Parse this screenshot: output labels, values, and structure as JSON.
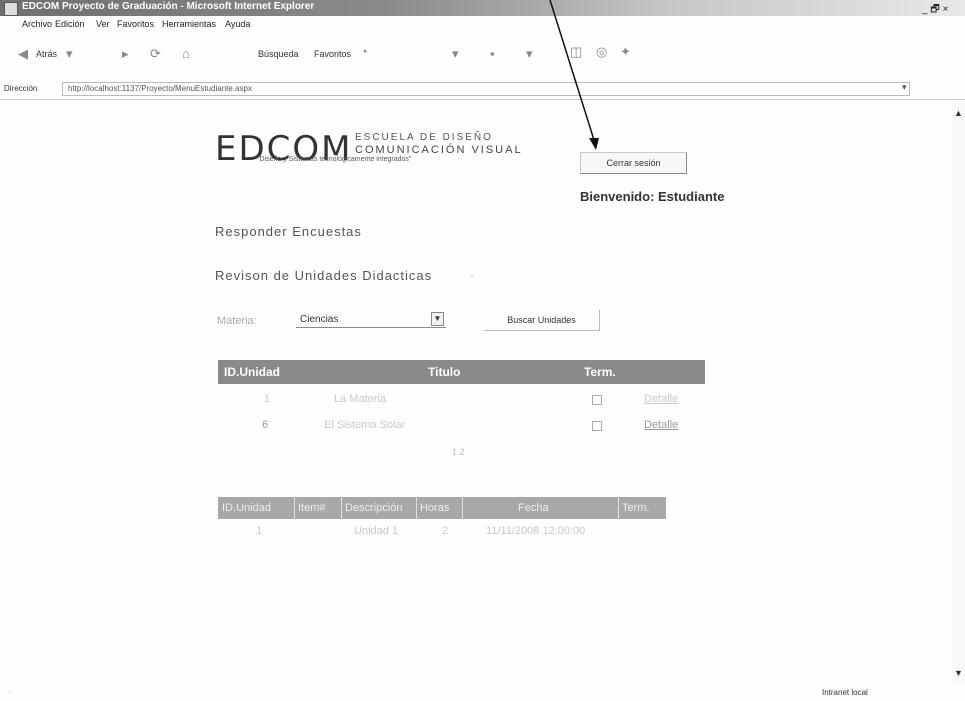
{
  "window": {
    "title": "EDCOM Proyecto de Graduación - Microsoft Internet Explorer",
    "controls": "_ 🗗 ×"
  },
  "menu": [
    "Archivo",
    "Edición",
    "Ver",
    "Favoritos",
    "Herramientas",
    "Ayuda"
  ],
  "toolbar": {
    "back": "Atrás",
    "search": "Búsqueda",
    "favorites": "Favoritos"
  },
  "address": {
    "label": "Dirección",
    "url": "http://localhost:1137/Proyecto/MenuEstudiante.aspx"
  },
  "page": {
    "logo": {
      "wordmark": "EDCOM",
      "side_top": "ESCUELA DE DISEÑO",
      "side_bottom": "COMUNICACIÓN VISUAL",
      "tagline": "\"Diseño y Sistemas tecnológicamente integrados\""
    },
    "logout_label": "Cerrar sesión",
    "welcome": "Bienvenido: Estudiante",
    "nav": {
      "surveys": "Responder Encuestas",
      "units": "Revison de Unidades Didacticas"
    },
    "subject": {
      "label": "Materia:",
      "value": "Ciencias"
    },
    "search_label": "Buscar Unidades",
    "units_table": {
      "headers": [
        "ID.Unidad",
        "Titulo",
        "Term.",
        ""
      ],
      "rows": [
        {
          "id": "1",
          "title": "La Materia",
          "link": "Detalle"
        },
        {
          "id": "6",
          "title": "El Sistema Solar",
          "link": "Detalle"
        }
      ],
      "pager": "1 2"
    },
    "items_table": {
      "headers": [
        "ID.Unidad",
        "Item#",
        "Descripción",
        "Horas",
        "Fecha",
        "Term."
      ],
      "rows": [
        {
          "id": "1",
          "item": "",
          "desc": "Unidad 1",
          "hours": "2",
          "date": "11/11/2008 12:00:00",
          "term": ""
        }
      ]
    }
  },
  "status": {
    "zone": "Intranet local"
  }
}
